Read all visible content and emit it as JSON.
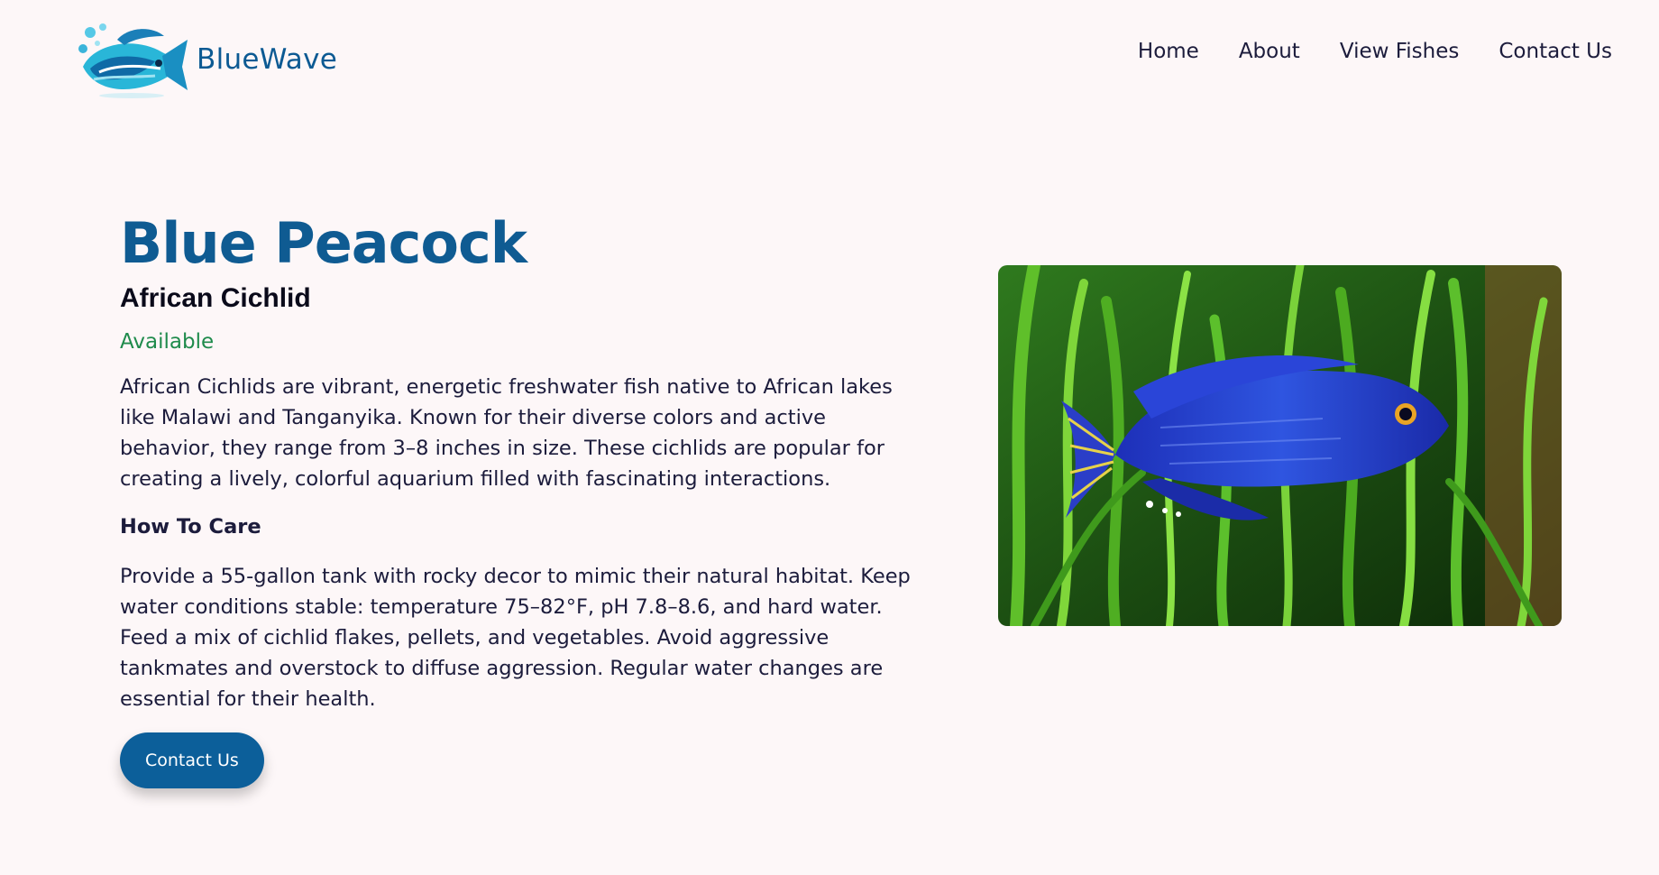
{
  "brand": {
    "name": "BlueWave",
    "logo_icon": "fish-logo-icon"
  },
  "nav": {
    "items": [
      "Home",
      "About",
      "View Fishes",
      "Contact Us"
    ]
  },
  "fish": {
    "name": "Blue Peacock",
    "type": "African Cichlid",
    "status": "Available",
    "description": "African Cichlids are vibrant, energetic freshwater fish native to African lakes like Malawi and Tanganyika. Known for their diverse colors and active behavior, they range from 3–8 inches in size. These cichlids are popular for creating a lively, colorful aquarium filled with fascinating interactions.",
    "care_heading": "How To Care",
    "care_text": "Provide a 55-gallon tank with rocky decor to mimic their natural habitat. Keep water conditions stable: temperature 75–82°F, pH 7.8–8.6, and hard water. Feed a mix of cichlid flakes, pellets, and vegetables. Avoid aggressive tankmates and overstock to diffuse aggression. Regular water changes are essential for their health.",
    "contact_button": "Contact Us",
    "image_icon": "blue-peacock-fish-photo"
  },
  "colors": {
    "background": "#fdf7f8",
    "brand": "#0c5a93",
    "title": "#0f5b92",
    "available": "#1f8b4c",
    "button": "#0c5f9a"
  }
}
